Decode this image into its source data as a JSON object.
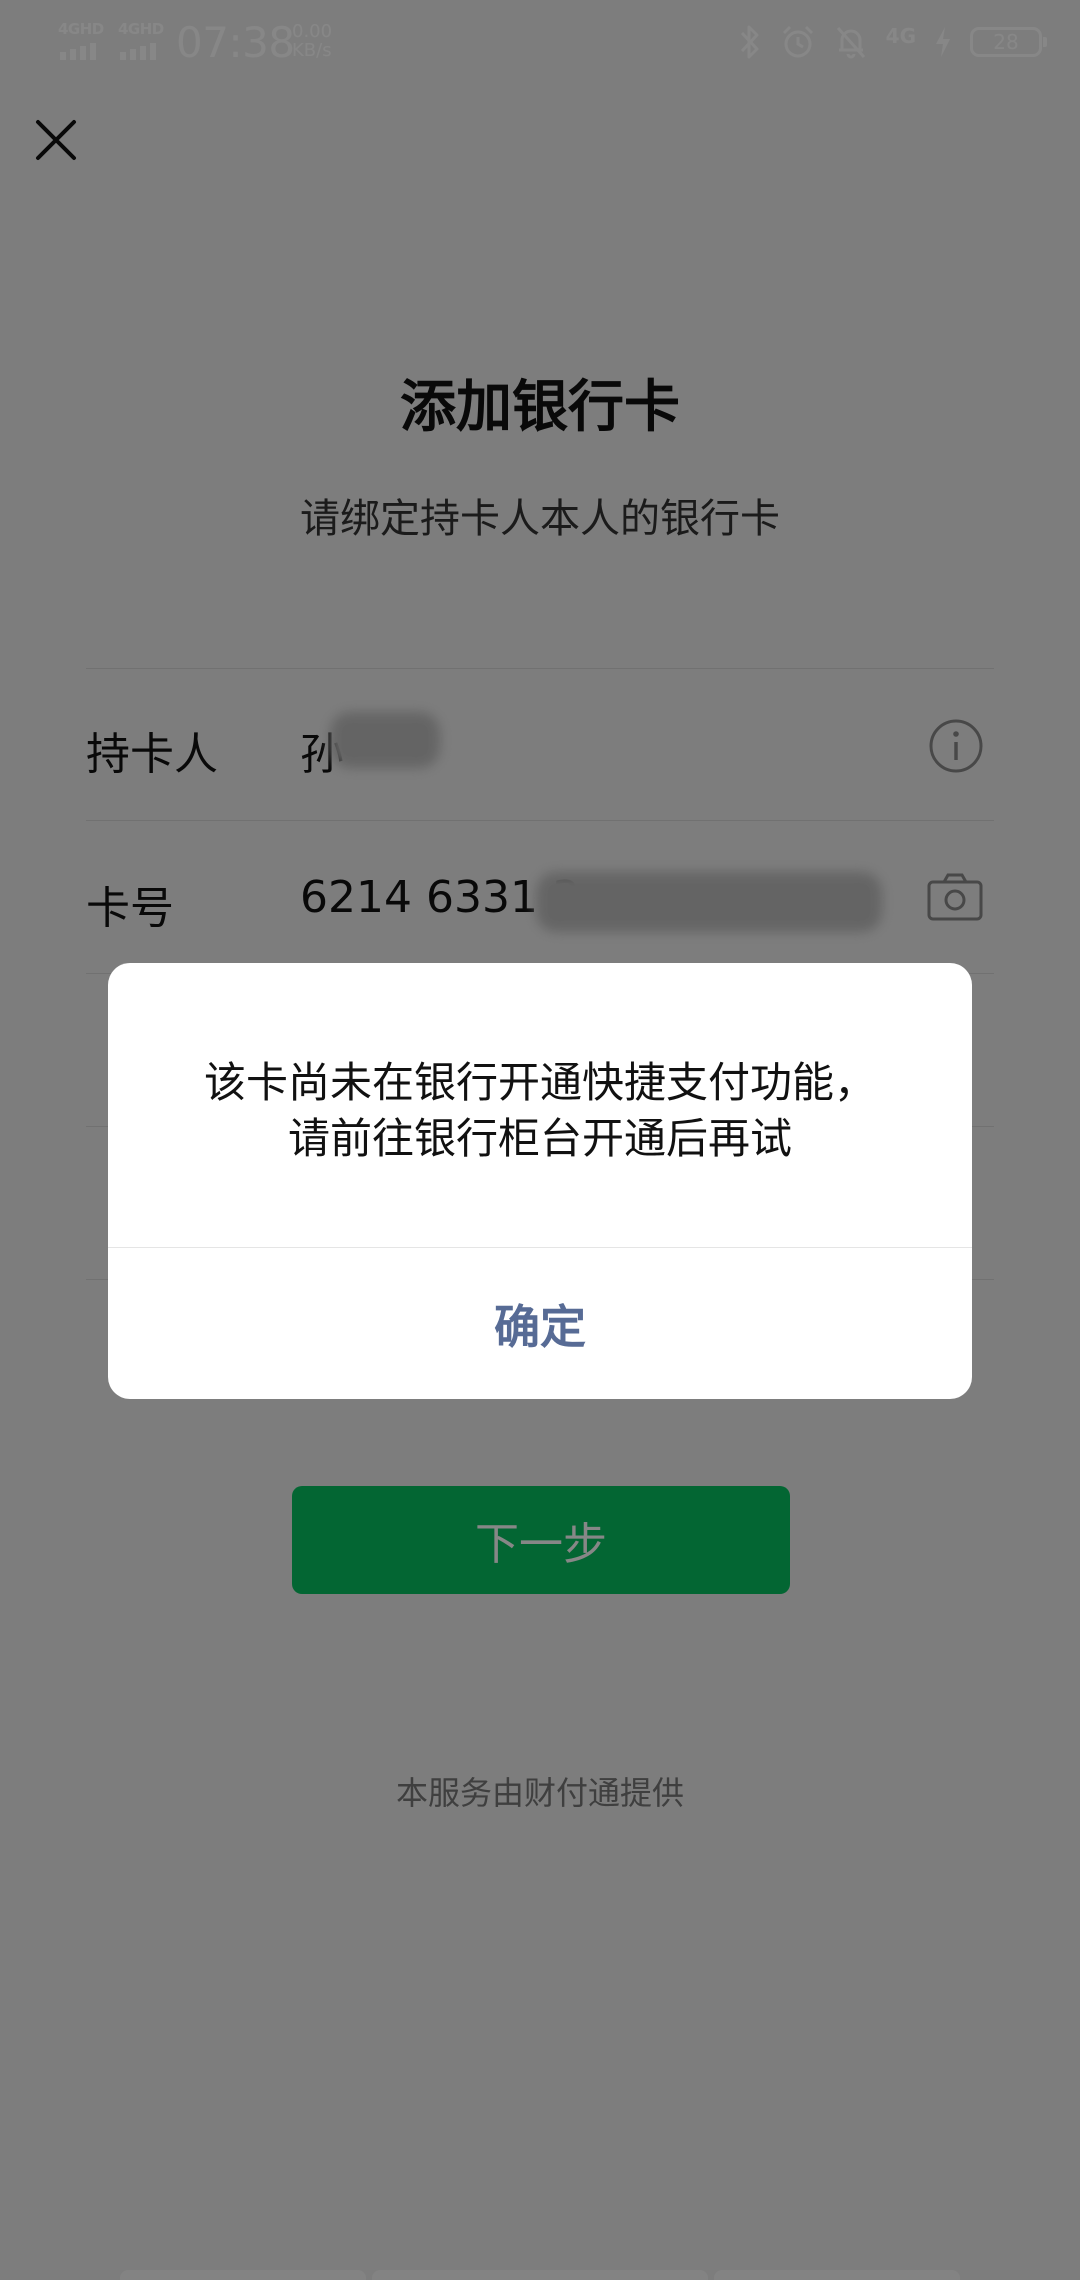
{
  "status_bar": {
    "signal_1": "4GHD",
    "signal_2": "4GHD",
    "time": "07:38",
    "net_speed_value": "0.00",
    "net_speed_unit": "KB/s",
    "network": "4G",
    "battery": "28",
    "icons": [
      "bluetooth-icon",
      "alarm-icon",
      "mute-bell-icon",
      "charging-icon"
    ]
  },
  "page": {
    "title": "添加银行卡",
    "subtitle": "请绑定持卡人本人的银行卡",
    "cardholder_label": "持卡人",
    "cardholder_value": "孙",
    "card_number_label": "卡号",
    "card_number_value": "6214 6331 3",
    "next_button": "下一步",
    "footer_note": "本服务由财付通提供"
  },
  "dialog": {
    "message": "该卡尚未在银行开通快捷支付功能，请前往银行柜台开通后再试",
    "confirm": "确定"
  },
  "colors": {
    "primary_green": "#07c160",
    "dialog_link": "#576b95",
    "overlay": "rgba(0,0,0,0.47)"
  }
}
